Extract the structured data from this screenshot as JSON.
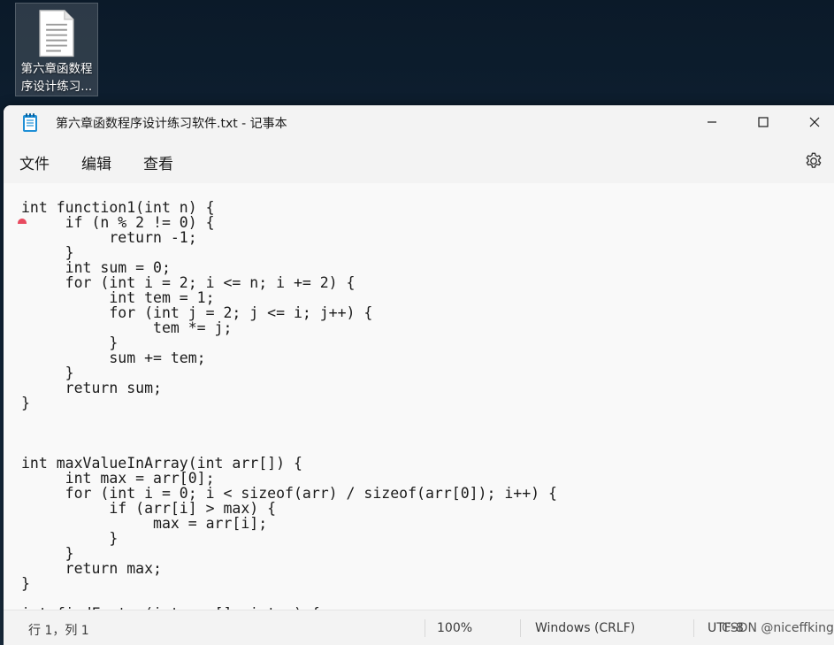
{
  "desktop": {
    "file_icon": "text-file-icon",
    "file_label_line1": "第六章函数程",
    "file_label_line2": "序设计练习..."
  },
  "window": {
    "app_icon": "notepad-icon",
    "title": "第六章函数程序设计练习软件.txt - 记事本",
    "minimize_icon": "minimize-icon",
    "maximize_icon": "maximize-icon",
    "close_icon": "close-icon"
  },
  "menu": {
    "file": "文件",
    "edit": "编辑",
    "view": "查看",
    "settings_icon": "gear-icon"
  },
  "editor": {
    "content": "int function1(int n) {\n     if (n % 2 != 0) {\n          return -1;\n     }\n     int sum = 0;\n     for (int i = 2; i <= n; i += 2) {\n          int tem = 1;\n          for (int j = 2; j <= i; j++) {\n               tem *= j;\n          }\n          sum += tem;\n     }\n     return sum;\n}\n\n\n\nint maxValueInArray(int arr[]) {\n     int max = arr[0];\n     for (int i = 0; i < sizeof(arr) / sizeof(arr[0]); i++) {\n          if (arr[i] > max) {\n               max = arr[i];\n          }\n     }\n     return max;\n}\n\nint findFactor(int arr[], int n) {"
  },
  "status": {
    "position": "行 1，列 1",
    "zoom": "100%",
    "line_ending": "Windows (CRLF)",
    "encoding": "UTF-8",
    "watermark": "CSDN @niceffking"
  },
  "colors": {
    "accent_marker": "#e84a5f",
    "notepad_icon": "#1f8fd6"
  }
}
